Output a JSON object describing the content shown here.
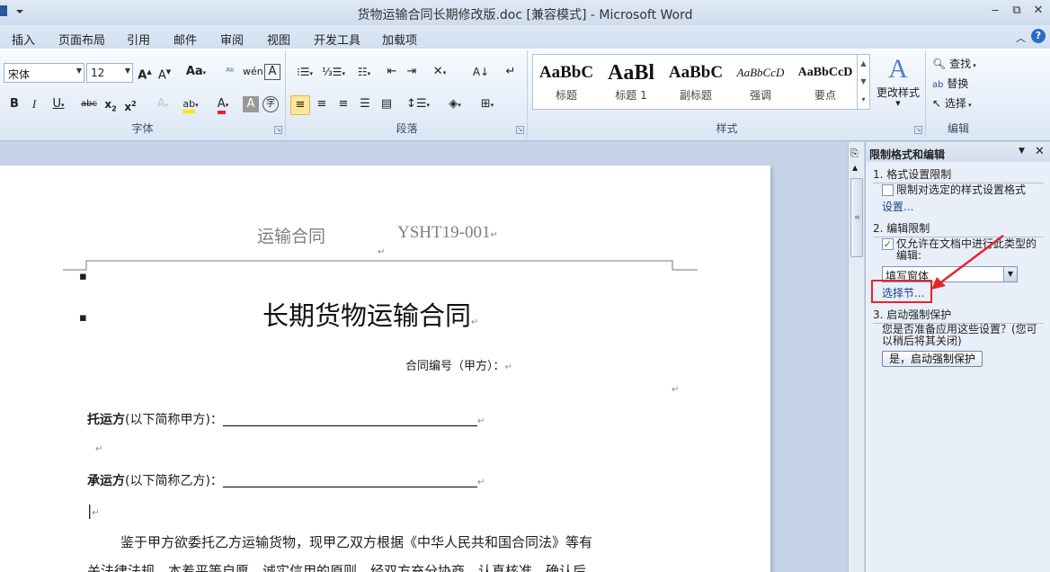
{
  "window": {
    "title": "货物运输合同长期修改版.doc [兼容模式] - Microsoft Word",
    "minimize": "▭",
    "restore": "⧉",
    "close": "✕"
  },
  "tabs": [
    "插入",
    "页面布局",
    "引用",
    "邮件",
    "审阅",
    "视图",
    "开发工具",
    "加载项"
  ],
  "ribbon": {
    "font_name": "宋体",
    "font_size": "12",
    "groups": {
      "font": "字体",
      "paragraph": "段落",
      "styles": "样式",
      "editing": "编辑"
    },
    "styles": [
      {
        "preview": "AaBbC",
        "name": "标题"
      },
      {
        "preview": "AaBl",
        "name": "标题 1"
      },
      {
        "preview": "AaBbC",
        "name": "副标题"
      },
      {
        "preview": "AaBbCcD",
        "name": "强调"
      },
      {
        "preview": "AaBbCcD",
        "name": "要点"
      }
    ],
    "change_styles": "更改样式",
    "find": "查找",
    "replace": "替换",
    "select": "选择"
  },
  "document": {
    "header_left": "运输合同",
    "header_right": "YSHT19-001",
    "title": "长期货物运输合同",
    "contract_no": "合同编号（甲方）：",
    "shipper_bold": "托运方",
    "shipper_rest": "(以下简称甲方)：",
    "carrier_bold": "承运方",
    "carrier_rest": "(以下简称乙方)：",
    "para1": "鉴于甲方欲委托乙方运输货物，现甲乙双方根据《中华人民共和国合同法》等有",
    "para2": "关法律法规，本着平等自愿、诚实信用的原则，经双方充分协商，认真核准，确认后"
  },
  "panel": {
    "title": "限制格式和编辑",
    "s1": "1. 格式设置限制",
    "s1_check": "限制对选定的样式设置格式",
    "s1_link": "设置...",
    "s2": "2. 编辑限制",
    "s2_check_line1": "仅允许在文档中进行此类型的",
    "s2_check_line2": "编辑:",
    "s2_select": "填写窗体",
    "s2_link": "选择节...",
    "s3": "3. 启动强制保护",
    "s3_q_line1": "您是否准备应用这些设置？(您可",
    "s3_q_line2": "以稍后将其关闭)",
    "s3_button": "是，启动强制保护"
  },
  "colors": {
    "annotation": "#e3262c",
    "accent": "#2b579a"
  }
}
